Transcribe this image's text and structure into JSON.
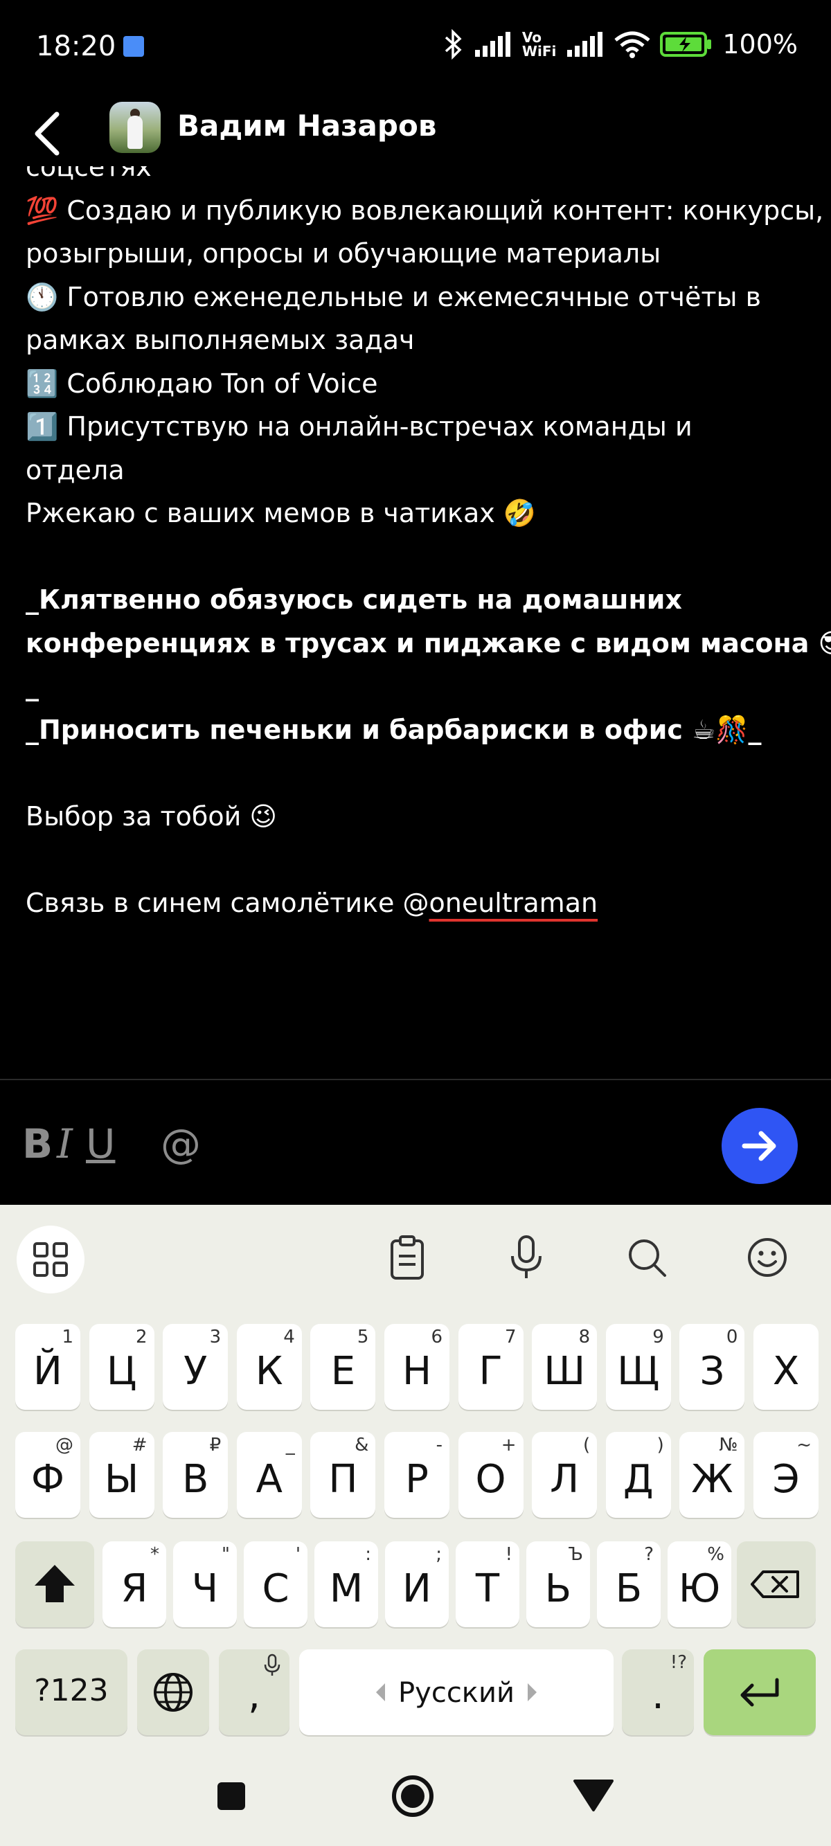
{
  "status": {
    "time": "18:20",
    "wifi_label_top": "Vo",
    "wifi_label_bottom": "WiFi",
    "battery_pct": "100%"
  },
  "header": {
    "contact_name": "Вадим Назаров"
  },
  "message": {
    "lines": [
      "соцсетях",
      "💯 Создаю и публикую вовлекающий контент: конкурсы,",
      "розыгрыши, опросы и обучающие материалы",
      "🕚 Готовлю еженедельные и ежемесячные отчёты в",
      "рамках выполняемых задач",
      "🔢 Соблюдаю Ton of Voice",
      "1️⃣ Присутствую на онлайн-встречах команды и",
      "отдела",
      "Ржекаю с ваших мемов в чатиках 🤣",
      "",
      "_Клятвенно обязуюсь сидеть на домашних",
      "конференциях в трусах и пиджаке с видом масона 😎",
      "_",
      "_Приносить печеньки и барбариски в офис ☕🎊_",
      "",
      "Выбор за тобой 😉",
      "",
      "Связь в синем самолётике @"
    ],
    "mention": "oneultraman"
  },
  "toolbar": {
    "bold": "B",
    "italic": "I",
    "underline": "U",
    "mention": "@"
  },
  "keyboard": {
    "row1": [
      {
        "key": "Й",
        "hint": "1"
      },
      {
        "key": "Ц",
        "hint": "2"
      },
      {
        "key": "У",
        "hint": "3"
      },
      {
        "key": "К",
        "hint": "4"
      },
      {
        "key": "Е",
        "hint": "5"
      },
      {
        "key": "Н",
        "hint": "6"
      },
      {
        "key": "Г",
        "hint": "7"
      },
      {
        "key": "Ш",
        "hint": "8"
      },
      {
        "key": "Щ",
        "hint": "9"
      },
      {
        "key": "З",
        "hint": "0"
      },
      {
        "key": "Х",
        "hint": ""
      }
    ],
    "row2": [
      {
        "key": "Ф",
        "hint": "@"
      },
      {
        "key": "Ы",
        "hint": "#"
      },
      {
        "key": "В",
        "hint": "₽"
      },
      {
        "key": "А",
        "hint": "_"
      },
      {
        "key": "П",
        "hint": "&"
      },
      {
        "key": "Р",
        "hint": "-"
      },
      {
        "key": "О",
        "hint": "+"
      },
      {
        "key": "Л",
        "hint": "("
      },
      {
        "key": "Д",
        "hint": ")"
      },
      {
        "key": "Ж",
        "hint": "№"
      },
      {
        "key": "Э",
        "hint": "~"
      }
    ],
    "row3": [
      {
        "key": "Я",
        "hint": "*"
      },
      {
        "key": "Ч",
        "hint": "\""
      },
      {
        "key": "С",
        "hint": "'"
      },
      {
        "key": "М",
        "hint": ":"
      },
      {
        "key": "И",
        "hint": ";"
      },
      {
        "key": "Т",
        "hint": "!"
      },
      {
        "key": "Ь",
        "hint": "Ъ"
      },
      {
        "key": "Б",
        "hint": "?"
      },
      {
        "key": "Ю",
        "hint": "%"
      }
    ],
    "symbols": "?123",
    "comma": ",",
    "space_label": "Русский",
    "period": ".",
    "period_hint": "!?"
  }
}
